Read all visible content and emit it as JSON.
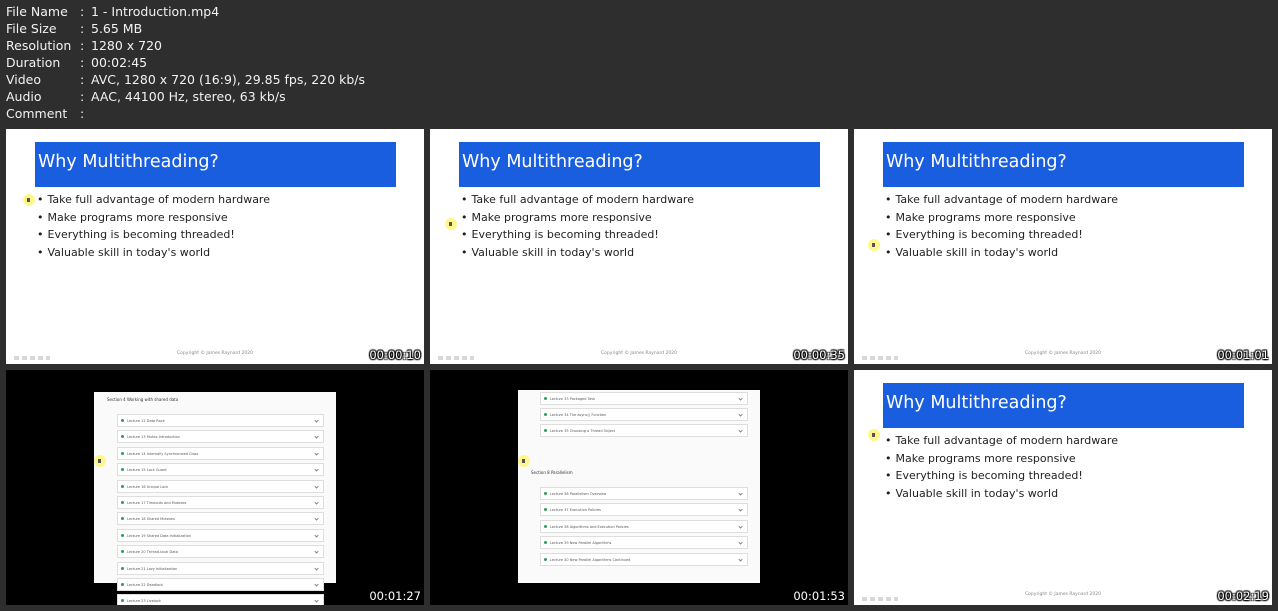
{
  "file_info": {
    "rows": [
      {
        "key": "File Name",
        "value": "1 - Introduction.mp4"
      },
      {
        "key": "File Size",
        "value": "5.65 MB"
      },
      {
        "key": "Resolution",
        "value": "1280 x 720"
      },
      {
        "key": "Duration",
        "value": "00:02:45"
      },
      {
        "key": "Video",
        "value": "AVC, 1280 x 720 (16:9), 29.85 fps, 220 kb/s"
      },
      {
        "key": "Audio",
        "value": "AAC, 44100 Hz, stereo, 63 kb/s"
      },
      {
        "key": "Comment",
        "value": ""
      }
    ],
    "separator": ":"
  },
  "slide": {
    "title": "Why Multithreading?",
    "bullets": [
      "Take full advantage of modern hardware",
      "Make programs more responsive",
      "Everything is becoming threaded!",
      "Valuable skill in today's world"
    ],
    "copyright": "Copyright © James Raynard 2020"
  },
  "thumbnails": [
    {
      "timestamp": "00:00:10",
      "kind": "slide"
    },
    {
      "timestamp": "00:00:35",
      "kind": "slide"
    },
    {
      "timestamp": "00:01:01",
      "kind": "slide"
    },
    {
      "timestamp": "00:01:27",
      "kind": "course-list"
    },
    {
      "timestamp": "00:01:53",
      "kind": "course-list"
    },
    {
      "timestamp": "00:02:19",
      "kind": "slide"
    }
  ],
  "course_list_a": {
    "section": "Section 4  Working with shared data",
    "lectures": [
      "Lecture 12  Data Race",
      "Lecture 13  Mutex Introduction",
      "Lecture 14  Internally Synchronized Class",
      "Lecture 15  Lock Guard",
      "Lecture 16  Unique Lock",
      "Lecture 17  Timeouts and Mutexes",
      "Lecture 18  Shared Mutexes",
      "Lecture 19  Shared Data Initialization",
      "Lecture 20  Thread-local Data",
      "Lecture 21  Lazy Initialization",
      "Lecture 22  Deadlock",
      "Lecture 23  Livelock"
    ]
  },
  "course_list_b": {
    "top_lectures": [
      "Lecture 33  Packaged Task",
      "Lecture 34  The async() Function",
      "Lecture 35  Choosing a Thread Object"
    ],
    "section": "Section 8  Parallelism",
    "lectures": [
      "Lecture 36  Parallelism Overview",
      "Lecture 37  Execution Policies",
      "Lecture 38  Algorithms and Execution Policies",
      "Lecture 39  New Parallel Algorithms",
      "Lecture 40  New Parallel Algorithms Continued"
    ]
  }
}
